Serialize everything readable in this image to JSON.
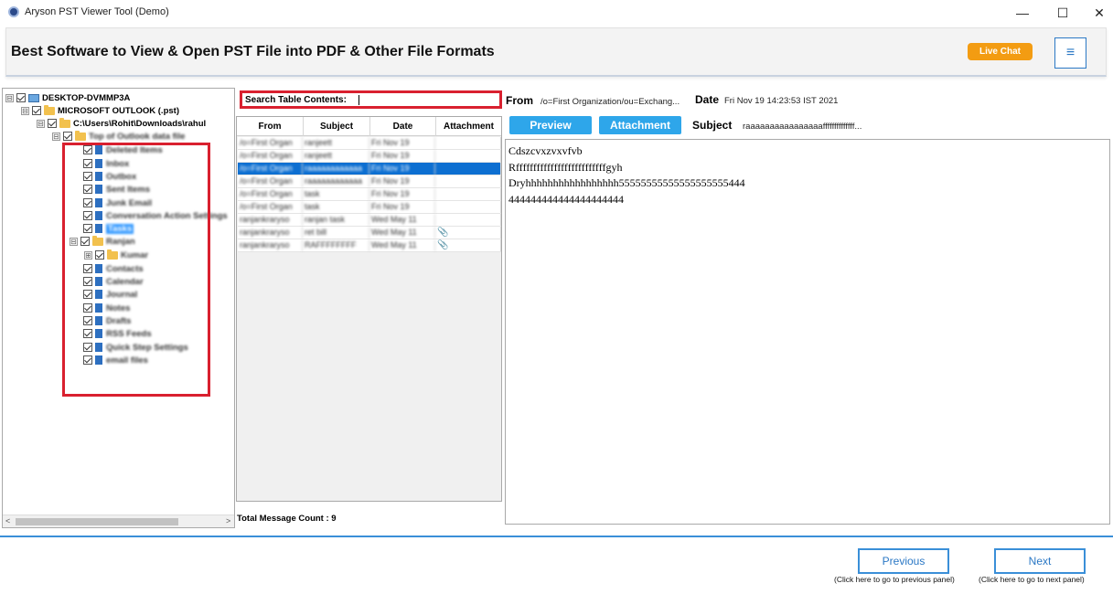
{
  "window": {
    "title": "Aryson PST Viewer Tool (Demo)",
    "minimize": "—",
    "maximize": "☐",
    "close": "✕"
  },
  "header": {
    "title": "Best Software to View & Open PST File into PDF & Other File Formats",
    "live_chat": "Live Chat",
    "menu_icon": "≡"
  },
  "tree": {
    "items": [
      {
        "label": "DESKTOP-DVMMP3A",
        "expander": "⊟"
      },
      {
        "label": "MICROSOFT OUTLOOK (.pst)",
        "expander": "⊟"
      },
      {
        "label": "C:\\Users\\Rohit\\Downloads\\rahul",
        "expander": "⊟"
      },
      {
        "label": "Top of Outlook data file",
        "expander": "⊟"
      },
      {
        "label": "Deleted Items"
      },
      {
        "label": "Inbox"
      },
      {
        "label": "Outbox"
      },
      {
        "label": "Sent Items"
      },
      {
        "label": "Junk Email"
      },
      {
        "label": "Conversation Action Settings"
      },
      {
        "label": "Tasks"
      },
      {
        "label": "Ranjan",
        "expander": "⊟"
      },
      {
        "label": "Kumar",
        "expander": "⊞"
      },
      {
        "label": "Contacts"
      },
      {
        "label": "Calendar"
      },
      {
        "label": "Journal"
      },
      {
        "label": "Notes"
      },
      {
        "label": "Drafts"
      },
      {
        "label": "RSS Feeds"
      },
      {
        "label": "Quick Step Settings"
      },
      {
        "label": "email files"
      }
    ],
    "scroll_left": "<",
    "scroll_right": ">"
  },
  "search": {
    "label": "Search Table Contents:"
  },
  "table": {
    "columns": [
      "From",
      "Subject",
      "Date",
      "Attachment"
    ],
    "rows": [
      {
        "from": "/o=First Organ",
        "subject": "ranjeett",
        "date": "Fri Nov 19",
        "att": ""
      },
      {
        "from": "/o=First Organ",
        "subject": "ranjeett",
        "date": "Fri Nov 19",
        "att": ""
      },
      {
        "from": "/o=First Organ",
        "subject": "raaaaaaaaaaaa",
        "date": "Fri Nov 19",
        "att": ""
      },
      {
        "from": "/o=First Organ",
        "subject": "raaaaaaaaaaaa",
        "date": "Fri Nov 19",
        "att": ""
      },
      {
        "from": "/o=First Organ",
        "subject": "task",
        "date": "Fri Nov 19",
        "att": ""
      },
      {
        "from": "/o=First Organ",
        "subject": "task",
        "date": "Fri Nov 19",
        "att": ""
      },
      {
        "from": "ranjankraryso",
        "subject": "ranjan task",
        "date": "Wed May 11",
        "att": ""
      },
      {
        "from": "ranjankraryso",
        "subject": "ret bill",
        "date": "Wed May 11",
        "att": "📎"
      },
      {
        "from": "ranjankraryso",
        "subject": "RAFFFFFFFF",
        "date": "Wed May 11",
        "att": "📎"
      }
    ],
    "total_label": "Total Message Count : 9"
  },
  "detail": {
    "from_label": "From",
    "from_value": "/o=First Organization/ou=Exchang...",
    "date_label": "Date",
    "date_value": "Fri Nov 19 14:23:53 IST 2021",
    "preview_tab": "Preview",
    "attachment_tab": "Attachment",
    "subject_label": "Subject",
    "subject_value": "raaaaaaaaaaaaaaaaffffffffffffff...",
    "body_lines": [
      "Cdszcvxzvxvfvb",
      "Rffffffffffffffffffffffffffgyh",
      "Dryhhhhhhhhhhhhhhhhh55555555555555555555444",
      "444444444444444444444"
    ]
  },
  "footer": {
    "previous": "Previous",
    "previous_hint": "(Click here to go to previous panel)",
    "next": "Next",
    "next_hint": "(Click here to go to next panel)"
  }
}
